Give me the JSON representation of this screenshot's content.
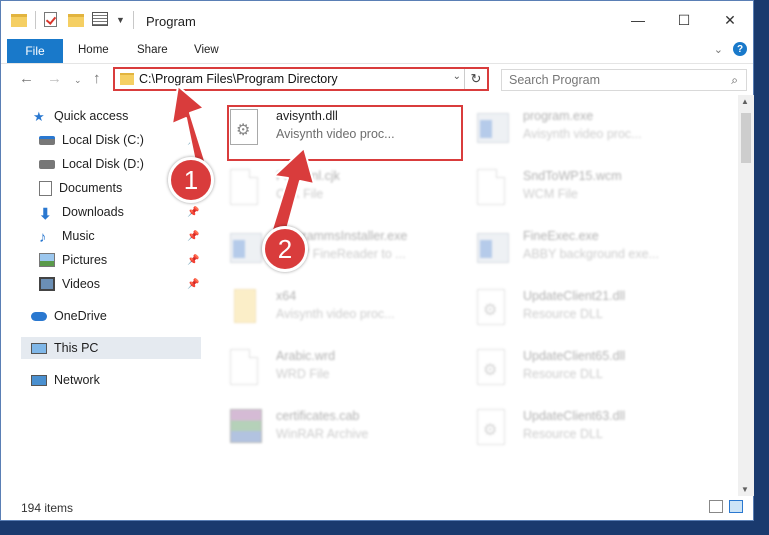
{
  "window": {
    "title": "Program"
  },
  "window_buttons": {
    "minimize": "—",
    "maximize": "☐",
    "close": "✕"
  },
  "ribbon": {
    "file": "File",
    "tabs": [
      "Home",
      "Share",
      "View"
    ]
  },
  "address_bar": {
    "path": "C:\\Program Files\\Program Directory"
  },
  "search": {
    "placeholder": "Search Program"
  },
  "sidebar": {
    "items": [
      {
        "label": "Quick access",
        "icon": "star-icon"
      },
      {
        "label": "Local Disk (C:)",
        "icon": "drive-icon",
        "pinned": true
      },
      {
        "label": "Local Disk (D:)",
        "icon": "drive-icon"
      },
      {
        "label": "Documents",
        "icon": "documents-icon",
        "pinned": true
      },
      {
        "label": "Downloads",
        "icon": "downloads-icon",
        "pinned": true
      },
      {
        "label": "Music",
        "icon": "music-icon",
        "pinned": true
      },
      {
        "label": "Pictures",
        "icon": "pictures-icon",
        "pinned": true
      },
      {
        "label": "Videos",
        "icon": "videos-icon",
        "pinned": true
      },
      {
        "label": "OneDrive",
        "icon": "onedrive-icon"
      },
      {
        "label": "This PC",
        "icon": "this-pc-icon",
        "selected": true
      },
      {
        "label": "Network",
        "icon": "network-icon"
      }
    ]
  },
  "files": [
    {
      "name": "avisynth.dll",
      "desc": "Avisynth video proc...",
      "icon": "dll-gear-icon",
      "highlighted": true
    },
    {
      "name": "program.exe",
      "desc": "Avisynth video proc...",
      "icon": "app-icon"
    },
    {
      "name": "FontMnl.cjk",
      "desc": "CJK File",
      "icon": "document-icon"
    },
    {
      "name": "SndToWP15.wcm",
      "desc": "WCM File",
      "icon": "document-icon"
    },
    {
      "name": "ProgrammsInstaller.exe",
      "desc": "ABBY FineReader to ...",
      "icon": "app-icon"
    },
    {
      "name": "FineExec.exe",
      "desc": "ABBY background exe...",
      "icon": "app-icon"
    },
    {
      "name": "x64",
      "desc": "Avisynth video proc...",
      "icon": "folder-icon"
    },
    {
      "name": "UpdateClient21.dll",
      "desc": "Resource DLL",
      "icon": "dll-gear-icon"
    },
    {
      "name": "Arabic.wrd",
      "desc": "WRD File",
      "icon": "document-icon"
    },
    {
      "name": "UpdateClient65.dll",
      "desc": "Resource DLL",
      "icon": "dll-gear-icon"
    },
    {
      "name": "certificates.cab",
      "desc": "WinRAR Archive",
      "icon": "archive-icon"
    },
    {
      "name": "UpdateClient63.dll",
      "desc": "Resource DLL",
      "icon": "dll-gear-icon"
    }
  ],
  "status": {
    "item_count": "194 items"
  },
  "annotations": {
    "step1": "1",
    "step2": "2",
    "color": "#d93c3c"
  }
}
